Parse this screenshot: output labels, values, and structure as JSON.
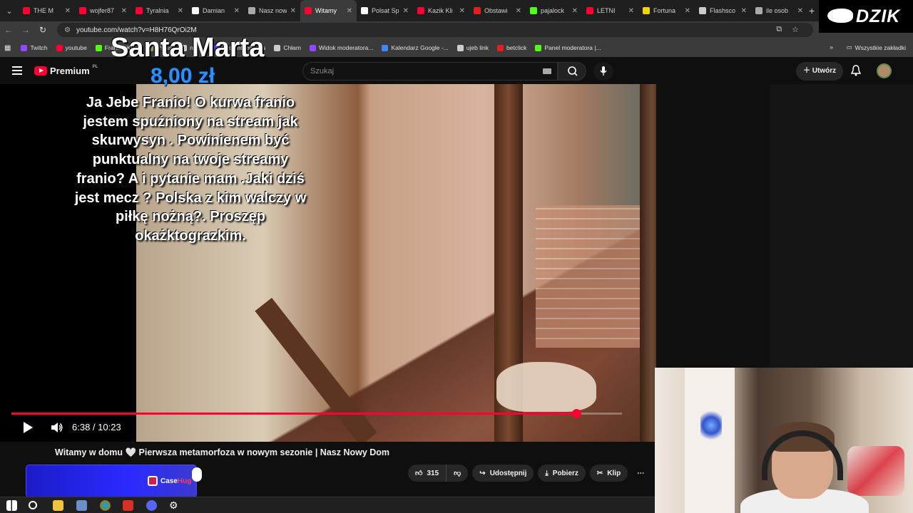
{
  "browser": {
    "tabs": [
      {
        "label": "THE M",
        "color": "#ff0033",
        "active": false
      },
      {
        "label": "wojfer87",
        "color": "#ff0033",
        "active": false
      },
      {
        "label": "Tyralnia",
        "color": "#ff0033",
        "active": false
      },
      {
        "label": "Damian",
        "color": "#ffffff",
        "active": false
      },
      {
        "label": "Nasz now",
        "color": "#aaaaaa",
        "active": false
      },
      {
        "label": "Witamy",
        "color": "#ff0033",
        "active": true
      },
      {
        "label": "Polsat Sp",
        "color": "#ffffff",
        "active": false
      },
      {
        "label": "Kazik Kli",
        "color": "#ff0033",
        "active": false
      },
      {
        "label": "Obstawi",
        "color": "#e02020",
        "active": false
      },
      {
        "label": "pajalock",
        "color": "#53fc18",
        "active": false
      },
      {
        "label": "LETNI",
        "color": "#ff0033",
        "active": false
      },
      {
        "label": "Fortuna",
        "color": "#f5d400",
        "active": false
      },
      {
        "label": "Flashsco",
        "color": "#cccccc",
        "active": false
      },
      {
        "label": "ile osob",
        "color": "#aaaaaa",
        "active": false
      }
    ],
    "url": "youtube.com/watch?v=H8H76QrOi2M",
    "bookmarks": [
      {
        "label": "Twitch",
        "color": "#9146ff"
      },
      {
        "label": "youtube",
        "color": "#ff0033"
      },
      {
        "label": "Franio | Kick",
        "color": "#53fc18"
      },
      {
        "label": "chess",
        "color": "#7fa650"
      },
      {
        "label": "nudy",
        "color": "#cccccc"
      },
      {
        "label": "StreamElements",
        "color": "#4040ff"
      },
      {
        "label": "Chłam",
        "color": "#cccccc"
      },
      {
        "label": "Widok moderatora...",
        "color": "#9146ff"
      },
      {
        "label": "Kalendarz Google -...",
        "color": "#4285f4"
      },
      {
        "label": "ujeb link",
        "color": "#cccccc"
      },
      {
        "label": "betclick",
        "color": "#e02020"
      },
      {
        "label": "Panel moderatora |...",
        "color": "#53fc18"
      }
    ],
    "all_bookmarks": "Wszystkie zakładki"
  },
  "youtube": {
    "logo_text": "Premium",
    "region": "PL",
    "search_placeholder": "Szukaj",
    "create_label": "Utwórz",
    "video_title": "Witamy w domu 🤍 Pierwsza metamorfoza w nowym sezonie | Nasz Nowy Dom",
    "time_current": "6:38",
    "time_total": "10:23",
    "time_display": "6:38 / 10:23",
    "progress_fraction": 0.925,
    "buffer_fraction": 1.0,
    "likes": "315",
    "share_label": "Udostępnij",
    "download_label": "Pobierz",
    "clip_label": "Klip"
  },
  "donation": {
    "name": "Santa Marta",
    "amount": "8,00 zł",
    "message": "Ja Jebe Franio! O kurwa franio jestem spuźniony na stream jak skurwysyn . Powinienem być punktualny na twoje streamy franio? A i pytanie mam .Jaki dziś jest mecz ? Polska z kim walczy w piłkę nożną?. Proszęp okażktograzkim."
  },
  "overlays": {
    "casehug_brand_a": "Case",
    "casehug_brand_b": "Hug",
    "dzik_logo": "DZIK"
  },
  "colors": {
    "yt_red": "#ff0033",
    "donation_amount": "#2b8fff",
    "casehug_blue": "#2a2aff"
  }
}
